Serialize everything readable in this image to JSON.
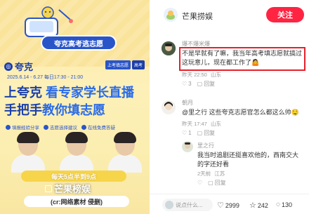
{
  "post_image": {
    "slogan": "夸克高考逃志愿",
    "brand": "夸克",
    "tags": [
      "上考填志愿",
      "高考"
    ],
    "date_line": "2025.6.14 - 6.27  每日17:30 - 21:00",
    "headline_1_pre": "上夸克 ",
    "headline_1_hl": "看专家学长直播",
    "headline_2_pre": "手把手",
    "headline_2_hl": "教你填志愿",
    "features": [
      "填报经验分享",
      "志愿选择建议",
      "在线免费答疑"
    ],
    "time_banner": "每天5点半到9点",
    "watermark": "芒果榜娱",
    "credit": "(cr:网络素材 侵删)"
  },
  "author": {
    "name": "芒果捞娱",
    "follow_label": "关注",
    "follow_color": "#ff2442"
  },
  "comments": [
    {
      "user": "爆不爆米爆",
      "text": "不是早就有了嘛，我当年高考填志愿就搞过这玩意儿，现在都工作了🤷",
      "time": "昨天 22:50",
      "location": "山东",
      "likes": "3",
      "reply_label": "回复"
    },
    {
      "user": "朝月",
      "text": "@里之行 这些夸克志愿官怎么都这么帅🤤",
      "time": "昨天 17:47",
      "location": "山东",
      "likes": "1",
      "reply_label": "回复"
    },
    {
      "user": "里之行",
      "text": "我当时追剧还挺喜欢他的，西南交大的字还好看",
      "time": "2天前",
      "location": "江苏",
      "likes": "",
      "reply_label": "回复"
    }
  ],
  "bottom_bar": {
    "placeholder": "说点什么...",
    "likes": "2999",
    "collects": "242",
    "comments": "130"
  }
}
